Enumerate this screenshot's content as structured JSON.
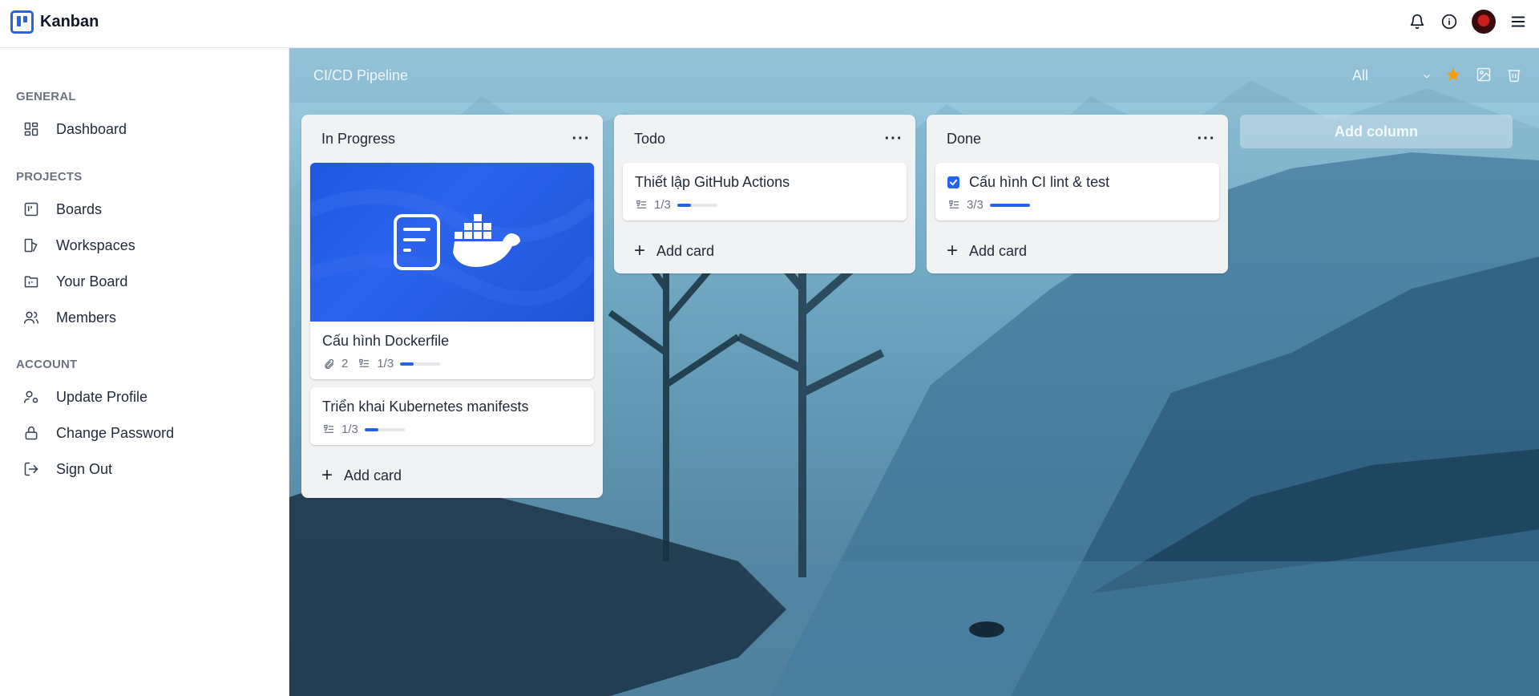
{
  "app": {
    "name": "Kanban"
  },
  "topbar": {
    "icons": [
      "bell-icon",
      "info-icon",
      "avatar",
      "menu-icon"
    ]
  },
  "sidebar": {
    "sections": [
      {
        "label": "GENERAL",
        "items": [
          {
            "label": "Dashboard",
            "icon": "dashboard-icon"
          }
        ]
      },
      {
        "label": "PROJECTS",
        "items": [
          {
            "label": "Boards",
            "icon": "boards-icon"
          },
          {
            "label": "Workspaces",
            "icon": "workspaces-icon"
          },
          {
            "label": "Your Board",
            "icon": "folder-icon"
          },
          {
            "label": "Members",
            "icon": "members-icon"
          }
        ]
      },
      {
        "label": "ACCOUNT",
        "items": [
          {
            "label": "Update Profile",
            "icon": "user-settings-icon"
          },
          {
            "label": "Change Password",
            "icon": "lock-icon"
          },
          {
            "label": "Sign Out",
            "icon": "sign-out-icon"
          }
        ]
      }
    ]
  },
  "board": {
    "title": "CI/CD Pipeline",
    "filter": "All",
    "add_column_label": "Add column",
    "add_card_label": "Add card",
    "columns": [
      {
        "title": "In Progress",
        "cards": [
          {
            "title": "Cấu hình Dockerfile",
            "attachments": "2",
            "checklist": "1/3",
            "progress": 0.333,
            "has_cover": true
          },
          {
            "title": "Triển khai Kubernetes manifests",
            "checklist": "1/3",
            "progress": 0.333
          }
        ]
      },
      {
        "title": "Todo",
        "cards": [
          {
            "title": "Thiết lập GitHub Actions",
            "checklist": "1/3",
            "progress": 0.333
          }
        ]
      },
      {
        "title": "Done",
        "cards": [
          {
            "title": "Cấu hình CI lint & test",
            "checklist": "3/3",
            "progress": 1,
            "completed": true
          }
        ]
      }
    ]
  },
  "colors": {
    "accent": "#2563eb",
    "star": "#f59e0b"
  }
}
